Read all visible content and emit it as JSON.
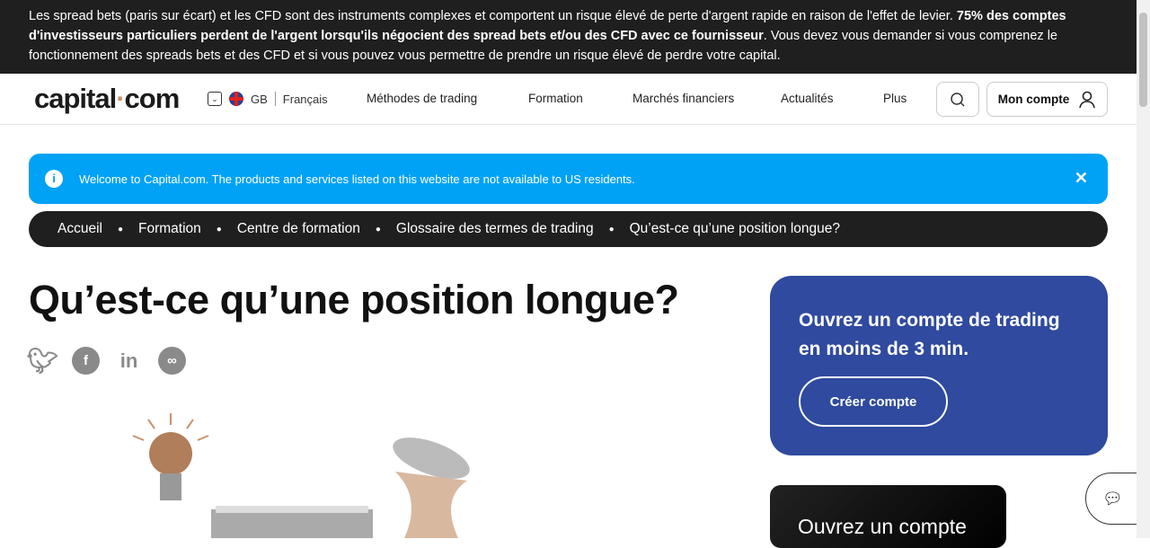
{
  "risk_warning": {
    "part1": "Les spread bets (paris sur écart) et les CFD sont des instruments complexes et comportent un risque élevé de perte d'argent rapide en raison de l'effet de levier. ",
    "bold": "75% des comptes d'investisseurs particuliers perdent de l'argent lorsqu'ils négocient des spread bets et/ou des CFD avec ce fournisseur",
    "part2": ". Vous devez vous demander si vous comprenez le fonctionnement des spreads bets et des CFD et si vous pouvez vous permettre de prendre un risque élevé de perdre votre capital."
  },
  "header": {
    "logo_a": "capital",
    "logo_dot": "·",
    "logo_b": "com",
    "region": "GB",
    "language": "Français",
    "menu": [
      "Méthodes de trading",
      "Formation",
      "Marchés financiers",
      "Actualités",
      "Plus"
    ],
    "account": "Mon compte"
  },
  "notice": {
    "text": "Welcome to Capital.com. The products and services listed on this website are not available to US residents."
  },
  "breadcrumb": [
    "Accueil",
    "Formation",
    "Centre de formation",
    "Glossaire des termes de trading",
    "Qu’est-ce qu’une position longue?"
  ],
  "page": {
    "title": "Qu’est-ce qu’une position longue?"
  },
  "cta": {
    "title": "Ouvrez un compte de trading en moins de 3 min.",
    "button": "Créer compte"
  },
  "promo": {
    "text": "Ouvrez un compte"
  }
}
